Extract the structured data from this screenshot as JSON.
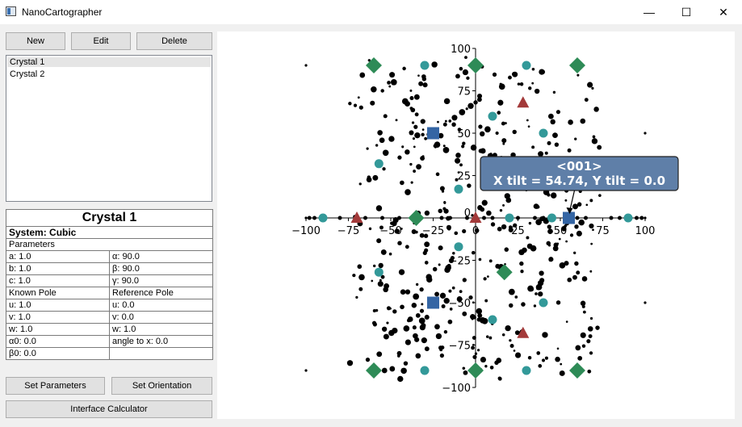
{
  "window": {
    "title": "NanoCartographer",
    "minimize": "—",
    "maximize": "☐",
    "close": "✕"
  },
  "toolbar": {
    "new_label": "New",
    "edit_label": "Edit",
    "delete_label": "Delete"
  },
  "crystals": [
    "Crystal 1",
    "Crystal 2"
  ],
  "properties": {
    "title": "Crystal 1",
    "system": "System: Cubic",
    "parameters_header": "Parameters",
    "a": "a: 1.0",
    "b": "b: 1.0",
    "c": "c: 1.0",
    "alpha": "α: 90.0",
    "beta": "β: 90.0",
    "gamma": "γ: 90.0",
    "known_pole": "Known Pole",
    "reference_pole": "Reference Pole",
    "u_known": "u: 1.0",
    "v_known": "v: 1.0",
    "w_known": "w: 1.0",
    "u_ref": "u: 0.0",
    "v_ref": "v: 0.0",
    "w_ref": "w: 1.0",
    "alpha0": "α0: 0.0",
    "angle_x": "angle to x: 0.0",
    "beta0": "β0: 0.0"
  },
  "buttons": {
    "set_parameters": "Set Parameters",
    "set_orientation": "Set Orientation",
    "interface_calculator": "Interface Calculator"
  },
  "chart_data": {
    "type": "scatter",
    "xlim": [
      -100,
      100
    ],
    "ylim": [
      -100,
      100
    ],
    "x_ticks": [
      "−100",
      "−50",
      "−25",
      "0",
      "25",
      "50",
      "75",
      "100"
    ],
    "x_tick_values": [
      -100,
      -50,
      -25,
      0,
      25,
      50,
      75,
      100
    ],
    "x_tick_label_minus75": "−75",
    "y_ticks": [
      "100",
      "75",
      "50",
      "25",
      "0",
      "−25",
      "−50",
      "−75",
      "−100"
    ],
    "y_tick_values": [
      100,
      75,
      50,
      25,
      0,
      -25,
      -50,
      -75,
      -100
    ],
    "colors": {
      "square": "#3465a4",
      "diamond": "#2e8b57",
      "triangle": "#a33a3a",
      "circle": "#339999",
      "dot": "#000000"
    },
    "squares": [
      [
        -25,
        50
      ],
      [
        55,
        0
      ],
      [
        -25,
        -50
      ]
    ],
    "diamonds": [
      [
        -60,
        90
      ],
      [
        0,
        90
      ],
      [
        60,
        90
      ],
      [
        -35,
        0
      ],
      [
        17,
        -32
      ],
      [
        -60,
        -90
      ],
      [
        0,
        -90
      ],
      [
        60,
        -90
      ]
    ],
    "triangles": [
      [
        -70,
        0
      ],
      [
        0,
        0
      ],
      [
        28,
        68
      ],
      [
        28,
        -68
      ]
    ],
    "circles": [
      [
        -30,
        90
      ],
      [
        30,
        90
      ],
      [
        10,
        60
      ],
      [
        40,
        50
      ],
      [
        -57,
        32
      ],
      [
        -10,
        17
      ],
      [
        -90,
        0
      ],
      [
        20,
        0
      ],
      [
        45,
        0
      ],
      [
        90,
        0
      ],
      [
        -57,
        -32
      ],
      [
        -10,
        -17
      ],
      [
        40,
        -50
      ],
      [
        10,
        -60
      ],
      [
        -30,
        -90
      ],
      [
        30,
        -90
      ]
    ],
    "annotation": {
      "line1": "<001>",
      "line2": "X tilt = 54.74, Y tilt = 0.0",
      "target": [
        55,
        0
      ],
      "box_color": "#5f7fa8"
    }
  }
}
